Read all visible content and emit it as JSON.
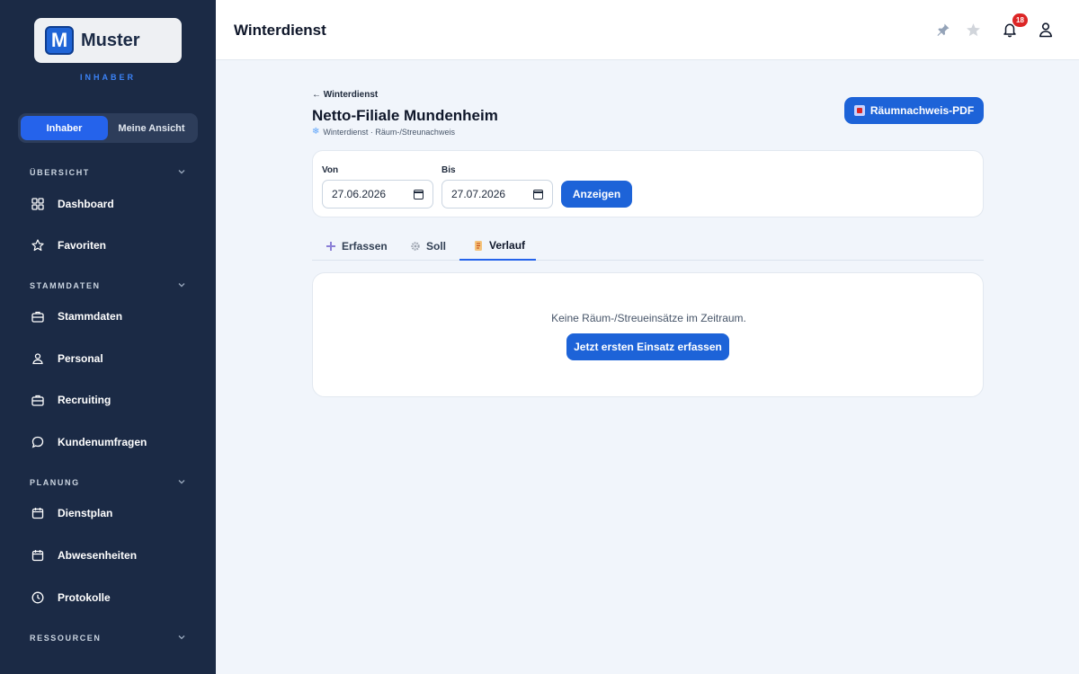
{
  "brand": {
    "name": "Muster",
    "mark": "M",
    "role_caption": "INHABER"
  },
  "view_switch": {
    "options": [
      "Inhaber",
      "Meine Ansicht"
    ],
    "active": "Inhaber"
  },
  "sidebar": {
    "sections": [
      {
        "label": "ÜBERSICHT",
        "items": [
          {
            "label": "Dashboard",
            "icon": "grid-icon"
          },
          {
            "label": "Favoriten",
            "icon": "star-icon"
          }
        ]
      },
      {
        "label": "STAMMDATEN",
        "items": [
          {
            "label": "Stammdaten",
            "icon": "briefcase-icon"
          },
          {
            "label": "Personal",
            "icon": "users-icon"
          },
          {
            "label": "Recruiting",
            "icon": "briefcase-icon"
          },
          {
            "label": "Kundenumfragen",
            "icon": "chat-icon"
          }
        ]
      },
      {
        "label": "PLANUNG",
        "items": [
          {
            "label": "Dienstplan",
            "icon": "calendar-icon"
          },
          {
            "label": "Abwesenheiten",
            "icon": "calendar-icon"
          },
          {
            "label": "Protokolle",
            "icon": "clock-icon"
          }
        ]
      },
      {
        "label": "RESSOURCEN",
        "items": []
      }
    ]
  },
  "topbar": {
    "title": "Winterdienst",
    "notification_count": "18"
  },
  "page": {
    "back_link": "← Winterdienst",
    "title": "Netto-Filiale Mundenheim",
    "subtitle": "Winterdienst · Räum-/Streunachweis",
    "pdf_button": "Räumnachweis-PDF"
  },
  "filter": {
    "from_label": "Von",
    "from_value": "27.06.2026",
    "to_label": "Bis",
    "to_value": "27.07.2026",
    "submit_label": "Anzeigen"
  },
  "tabs": [
    {
      "label": "Erfassen",
      "icon": "plus-icon",
      "active": false
    },
    {
      "label": "Soll",
      "icon": "gear-icon",
      "active": false
    },
    {
      "label": "Verlauf",
      "icon": "scroll-icon",
      "active": true
    }
  ],
  "empty_state": {
    "message": "Keine Räum-/Streueinsätze im Zeitraum.",
    "cta": "Jetzt ersten Einsatz erfassen"
  },
  "colors": {
    "sidebar_bg": "#1b2a45",
    "accent": "#1d63d8",
    "badge": "#dc2626",
    "page_bg": "#f1f5fb"
  }
}
